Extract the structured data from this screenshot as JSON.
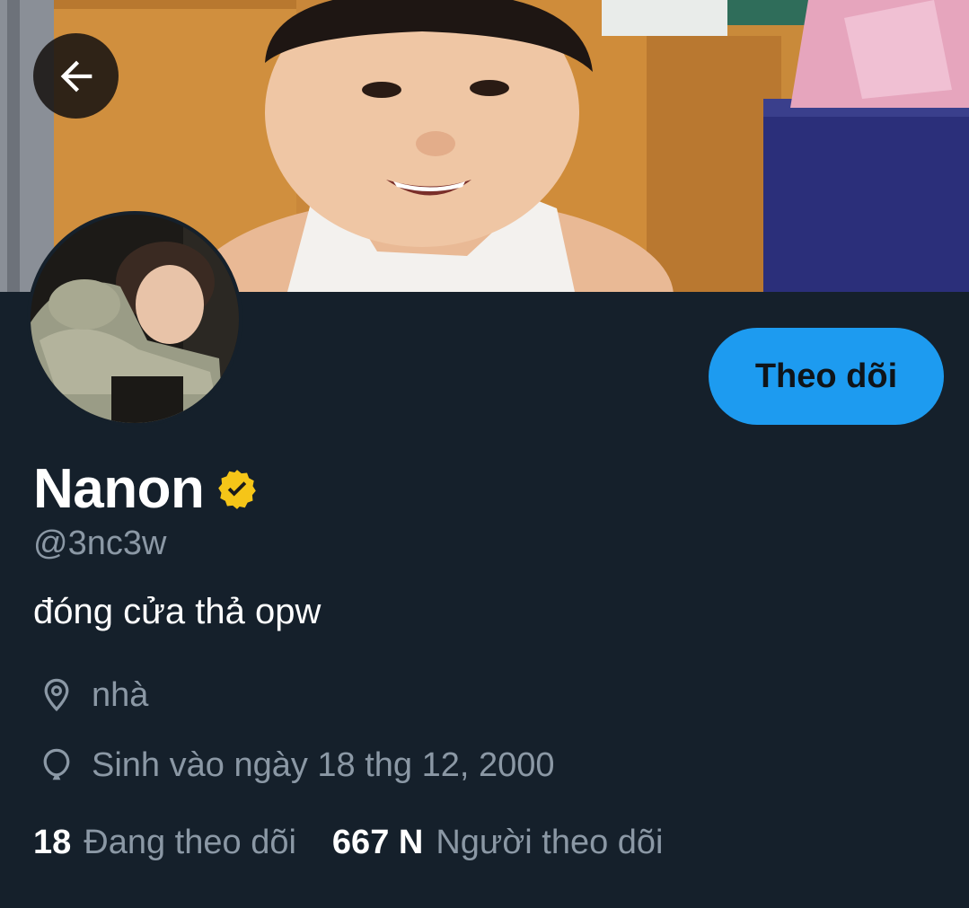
{
  "profile": {
    "display_name": "Nanon",
    "handle": "@3nc3w",
    "bio": "đóng cửa thả opw",
    "location": "nhà",
    "birthday": "Sinh vào ngày 18 thg 12, 2000",
    "verified": true
  },
  "actions": {
    "follow_label": "Theo dõi"
  },
  "stats": {
    "following_count": "18",
    "following_label": "Đang theo dõi",
    "followers_count": "667 N",
    "followers_label": "Người theo dõi"
  },
  "icons": {
    "back": "arrow-left-icon",
    "verified": "verified-badge-icon",
    "location": "location-pin-icon",
    "birthday": "balloon-icon"
  },
  "colors": {
    "background": "#15202b",
    "accent": "#1d9bf0",
    "verified_gold": "#f5c518",
    "secondary_text": "#8b98a5",
    "primary_text": "#ffffff"
  }
}
